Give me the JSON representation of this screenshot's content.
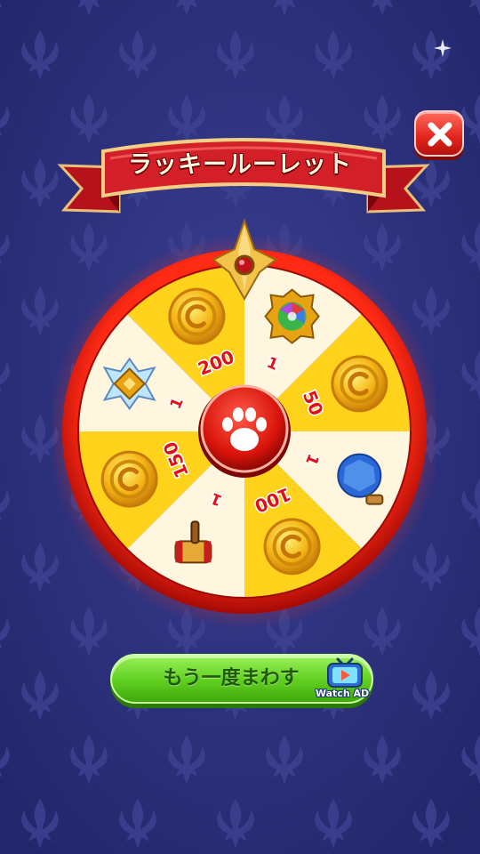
{
  "banner": {
    "title": "ラッキールーレット"
  },
  "close_button": {
    "icon": "close-icon"
  },
  "wheel": {
    "center_icon": "paw-icon",
    "segments": [
      {
        "reward": "coin",
        "label": "200"
      },
      {
        "reward": "gem",
        "label": "1"
      },
      {
        "reward": "coin",
        "label": "50"
      },
      {
        "reward": "crystal-potion",
        "label": "1"
      },
      {
        "reward": "coin",
        "label": "100"
      },
      {
        "reward": "hammer",
        "label": "1"
      },
      {
        "reward": "coin",
        "label": "150"
      },
      {
        "reward": "crystal-cross",
        "label": "1"
      }
    ]
  },
  "spin_again": {
    "label": "もう一度まわす",
    "badge": "Watch AD",
    "icon": "tv-icon"
  },
  "colors": {
    "background": "#2b2f78",
    "rim": "#e01a0e",
    "segment_yellow": "#ffd21c",
    "segment_cream": "#fff6e0",
    "button_green": "#5fcf1f"
  }
}
